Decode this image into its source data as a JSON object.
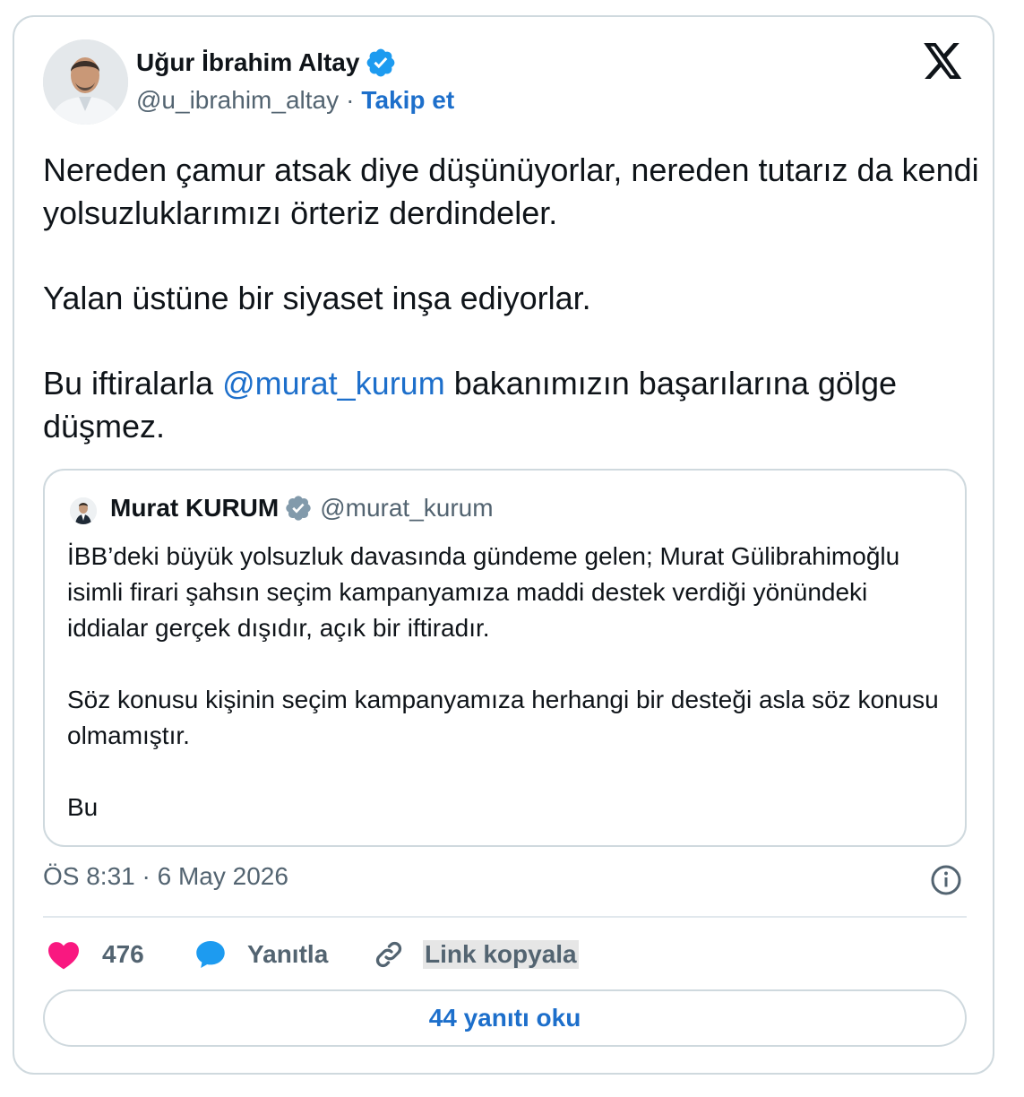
{
  "author": {
    "name": "Uğur İbrahim Altay",
    "handle": "@u_ibrahim_altay",
    "separator": "·",
    "follow_label": "Takip et"
  },
  "tweet": {
    "p1": "Nereden çamur atsak diye düşünüyorlar, nereden tutarız da kendi yolsuzluklarımızı örteriz derdindeler.",
    "p2": "Yalan üstüne bir siyaset inşa ediyorlar.",
    "p3_before": "Bu iftiralarla ",
    "p3_mention": "@murat_kurum",
    "p3_after": " bakanımızın başarılarına gölge düşmez."
  },
  "quote": {
    "name": "Murat KURUM",
    "handle": "@murat_kurum",
    "p1": "İBB’deki büyük yolsuzluk davasında gündeme gelen; Murat Gülibrahimoğlu isimli firari şahsın seçim kampanyamıza maddi destek verdiği yönündeki iddialar gerçek dışıdır, açık bir iftiradır.",
    "p2": "Söz konusu kişinin seçim kampanyamıza herhangi bir desteği asla söz konusu olmamıştır.",
    "p3": "Bu"
  },
  "meta": {
    "timestamp": "ÖS 8:31 · 6 May 2026"
  },
  "actions": {
    "like_count": "476",
    "reply_label": "Yanıtla",
    "copy_label": "Link kopyala",
    "read_replies_label": "44 yanıtı oku"
  },
  "icons": {
    "verified": "verified-badge-icon",
    "x_logo": "x-logo-icon",
    "info": "info-icon",
    "heart": "heart-icon",
    "reply": "reply-bubble-icon",
    "link": "link-icon"
  },
  "colors": {
    "accent": "#1d6fcb",
    "verified": "#1d9bf0",
    "heart": "#f91880",
    "muted": "#536471",
    "border": "#cfd9de"
  }
}
